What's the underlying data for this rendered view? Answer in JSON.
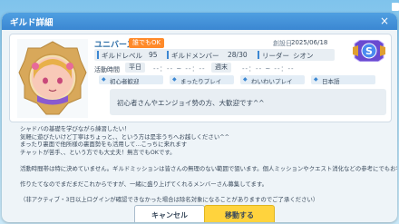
{
  "window": {
    "title": "ギルド詳細",
    "close_label": "×"
  },
  "guild": {
    "name": "ユニバース",
    "join_status": "誰でもOK",
    "founded_label": "創設日",
    "founded_date": "2025/06/18",
    "rank": "S",
    "level_label": "ギルドレベル",
    "level": "95",
    "members_label": "ギルドメンバー",
    "members": "28/30",
    "leader_label": "リーダー",
    "leader": "シオン",
    "activity_label": "活動時間",
    "weekday_label": "平日",
    "weekday_time": "--：-- ~ --：--",
    "weekend_label": "週末",
    "weekend_time": "--：-- ~ --：--",
    "tags": [
      "初心者歓迎",
      "まったりプレイ",
      "わいわいプレイ",
      "日本語"
    ],
    "motto": "初心者さんやエンジョイ勢の方、大歓迎です^^"
  },
  "description": [
    "シャドバの基礎を学びながら練習したい！",
    "気軽に遊びたいけど丁寧はちょっと、、という方は是非うちへお越しください^^",
    "まったり裏面で他所様の裏面勢をも活用して...こっちに来れます",
    "チャットが苦手、、という方でも大丈夫！無言でもOKです。",
    "",
    "活動時間帯は特に決めていません。ギルドミッションは皆さんの無理のない範囲で狙います。個人ミッションやクエスト消化などの参考にでもお手伝いします！",
    "",
    "作りたてなのでまだまだこれからですが、一緒に盛り上げてくれるメンバーさん募集してます。",
    "",
    "（非アクティブ・3日以上ログインが確認できなかった場合は除名対象になることがありますのでご了承ください）"
  ],
  "buttons": {
    "cancel": "キャンセル",
    "move": "移動する"
  },
  "colors": {
    "header": "#3b87d2",
    "accent": "#ff8a2a",
    "primary_button": "#ffd33d"
  }
}
